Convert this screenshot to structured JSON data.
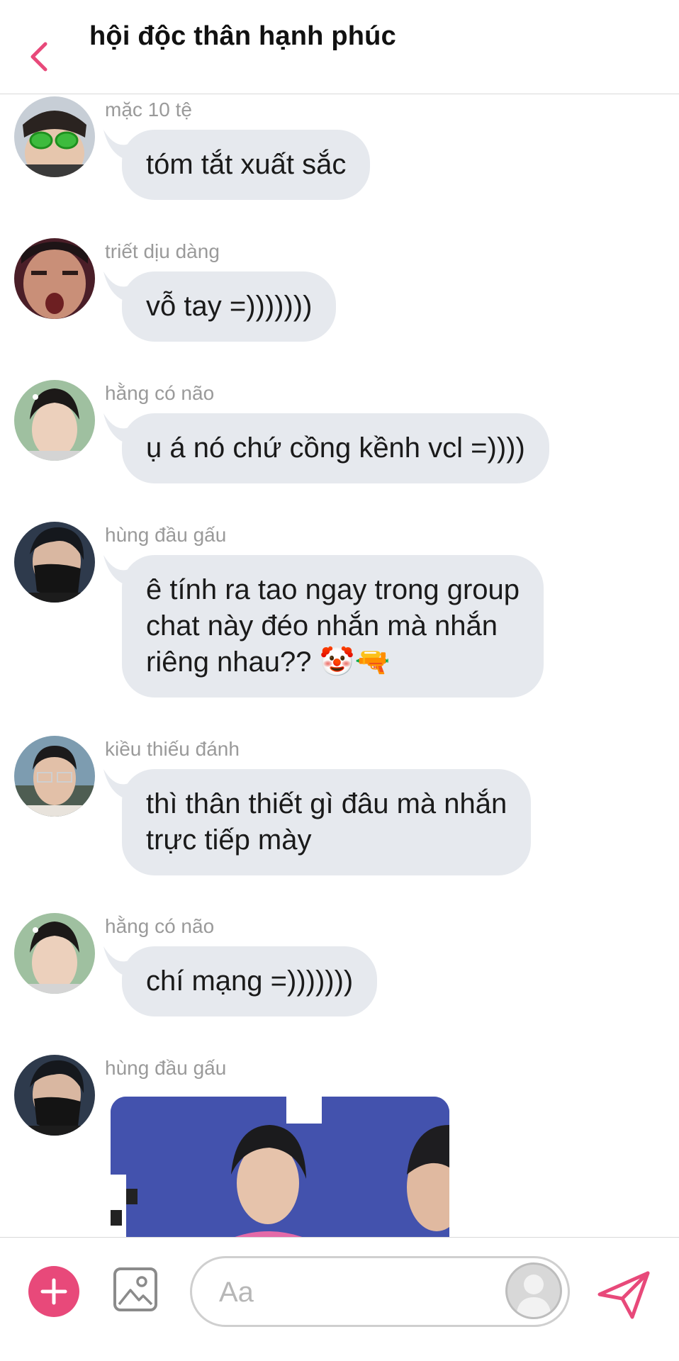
{
  "header": {
    "title": "hội độc thân hạnh phúc"
  },
  "messages": [
    {
      "sender": "mặc 10 tệ",
      "text": "tóm tắt xuất sắc",
      "avatar": "avatar-green-glasses"
    },
    {
      "sender": "triết dịu dàng",
      "text": "vỗ tay =)))))))",
      "avatar": "avatar-shouting-man"
    },
    {
      "sender": "hằng có não",
      "text": "ụ á nó chứ cồng kềnh vcl =))))",
      "avatar": "avatar-young-man"
    },
    {
      "sender": "hùng đầu gấu",
      "text": "ê tính ra tao ngay trong group\nchat này đéo nhắn mà nhắn\nriêng nhau?? 🤡🔫",
      "avatar": "avatar-masked-man"
    },
    {
      "sender": "kiều thiếu đánh",
      "text": "thì thân thiết gì đâu mà nhắn\ntrực tiếp mày",
      "avatar": "avatar-glasses-man"
    },
    {
      "sender": "hằng có não",
      "text": "chí mạng =)))))))",
      "avatar": "avatar-young-man"
    },
    {
      "sender": "hùng đầu gấu",
      "text": "",
      "avatar": "avatar-masked-man",
      "attachment": "gif-image"
    }
  ],
  "input": {
    "placeholder": "Aa"
  },
  "colors": {
    "accent": "#e8497a",
    "bubble": "#e6e9ee",
    "meta": "#9a9a9a"
  }
}
